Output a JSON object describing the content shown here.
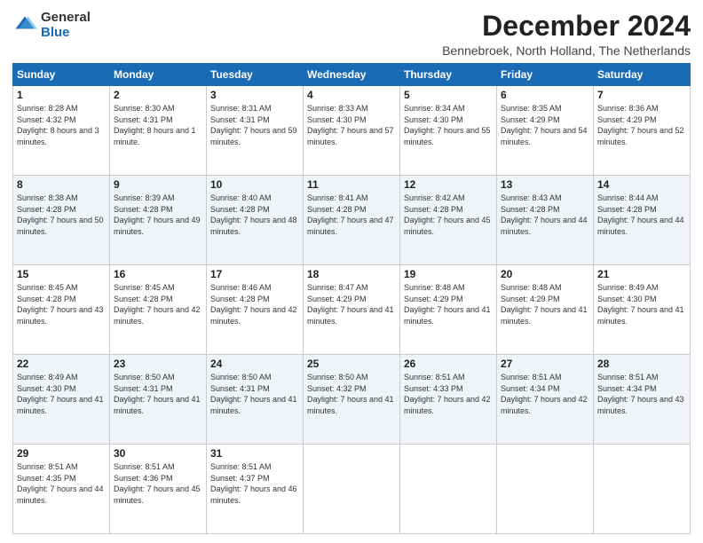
{
  "logo": {
    "general": "General",
    "blue": "Blue"
  },
  "header": {
    "month": "December 2024",
    "location": "Bennebroek, North Holland, The Netherlands"
  },
  "days_of_week": [
    "Sunday",
    "Monday",
    "Tuesday",
    "Wednesday",
    "Thursday",
    "Friday",
    "Saturday"
  ],
  "weeks": [
    [
      {
        "day": "1",
        "sunrise": "8:28 AM",
        "sunset": "4:32 PM",
        "daylight": "8 hours and 3 minutes."
      },
      {
        "day": "2",
        "sunrise": "8:30 AM",
        "sunset": "4:31 PM",
        "daylight": "8 hours and 1 minute."
      },
      {
        "day": "3",
        "sunrise": "8:31 AM",
        "sunset": "4:31 PM",
        "daylight": "7 hours and 59 minutes."
      },
      {
        "day": "4",
        "sunrise": "8:33 AM",
        "sunset": "4:30 PM",
        "daylight": "7 hours and 57 minutes."
      },
      {
        "day": "5",
        "sunrise": "8:34 AM",
        "sunset": "4:30 PM",
        "daylight": "7 hours and 55 minutes."
      },
      {
        "day": "6",
        "sunrise": "8:35 AM",
        "sunset": "4:29 PM",
        "daylight": "7 hours and 54 minutes."
      },
      {
        "day": "7",
        "sunrise": "8:36 AM",
        "sunset": "4:29 PM",
        "daylight": "7 hours and 52 minutes."
      }
    ],
    [
      {
        "day": "8",
        "sunrise": "8:38 AM",
        "sunset": "4:28 PM",
        "daylight": "7 hours and 50 minutes."
      },
      {
        "day": "9",
        "sunrise": "8:39 AM",
        "sunset": "4:28 PM",
        "daylight": "7 hours and 49 minutes."
      },
      {
        "day": "10",
        "sunrise": "8:40 AM",
        "sunset": "4:28 PM",
        "daylight": "7 hours and 48 minutes."
      },
      {
        "day": "11",
        "sunrise": "8:41 AM",
        "sunset": "4:28 PM",
        "daylight": "7 hours and 47 minutes."
      },
      {
        "day": "12",
        "sunrise": "8:42 AM",
        "sunset": "4:28 PM",
        "daylight": "7 hours and 45 minutes."
      },
      {
        "day": "13",
        "sunrise": "8:43 AM",
        "sunset": "4:28 PM",
        "daylight": "7 hours and 44 minutes."
      },
      {
        "day": "14",
        "sunrise": "8:44 AM",
        "sunset": "4:28 PM",
        "daylight": "7 hours and 44 minutes."
      }
    ],
    [
      {
        "day": "15",
        "sunrise": "8:45 AM",
        "sunset": "4:28 PM",
        "daylight": "7 hours and 43 minutes."
      },
      {
        "day": "16",
        "sunrise": "8:45 AM",
        "sunset": "4:28 PM",
        "daylight": "7 hours and 42 minutes."
      },
      {
        "day": "17",
        "sunrise": "8:46 AM",
        "sunset": "4:28 PM",
        "daylight": "7 hours and 42 minutes."
      },
      {
        "day": "18",
        "sunrise": "8:47 AM",
        "sunset": "4:29 PM",
        "daylight": "7 hours and 41 minutes."
      },
      {
        "day": "19",
        "sunrise": "8:48 AM",
        "sunset": "4:29 PM",
        "daylight": "7 hours and 41 minutes."
      },
      {
        "day": "20",
        "sunrise": "8:48 AM",
        "sunset": "4:29 PM",
        "daylight": "7 hours and 41 minutes."
      },
      {
        "day": "21",
        "sunrise": "8:49 AM",
        "sunset": "4:30 PM",
        "daylight": "7 hours and 41 minutes."
      }
    ],
    [
      {
        "day": "22",
        "sunrise": "8:49 AM",
        "sunset": "4:30 PM",
        "daylight": "7 hours and 41 minutes."
      },
      {
        "day": "23",
        "sunrise": "8:50 AM",
        "sunset": "4:31 PM",
        "daylight": "7 hours and 41 minutes."
      },
      {
        "day": "24",
        "sunrise": "8:50 AM",
        "sunset": "4:31 PM",
        "daylight": "7 hours and 41 minutes."
      },
      {
        "day": "25",
        "sunrise": "8:50 AM",
        "sunset": "4:32 PM",
        "daylight": "7 hours and 41 minutes."
      },
      {
        "day": "26",
        "sunrise": "8:51 AM",
        "sunset": "4:33 PM",
        "daylight": "7 hours and 42 minutes."
      },
      {
        "day": "27",
        "sunrise": "8:51 AM",
        "sunset": "4:34 PM",
        "daylight": "7 hours and 42 minutes."
      },
      {
        "day": "28",
        "sunrise": "8:51 AM",
        "sunset": "4:34 PM",
        "daylight": "7 hours and 43 minutes."
      }
    ],
    [
      {
        "day": "29",
        "sunrise": "8:51 AM",
        "sunset": "4:35 PM",
        "daylight": "7 hours and 44 minutes."
      },
      {
        "day": "30",
        "sunrise": "8:51 AM",
        "sunset": "4:36 PM",
        "daylight": "7 hours and 45 minutes."
      },
      {
        "day": "31",
        "sunrise": "8:51 AM",
        "sunset": "4:37 PM",
        "daylight": "7 hours and 46 minutes."
      },
      null,
      null,
      null,
      null
    ]
  ]
}
